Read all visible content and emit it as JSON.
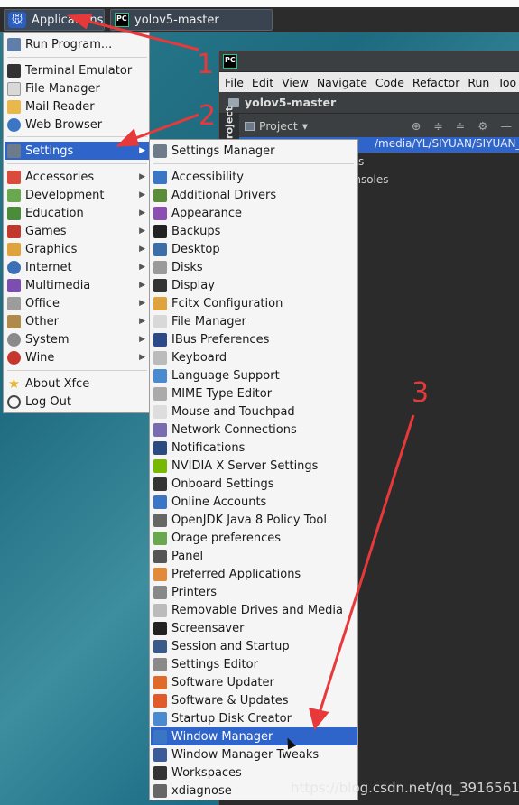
{
  "panel": {
    "apps_label": "Applications",
    "task_label": "yolov5-master"
  },
  "ide": {
    "app_icon": "PC",
    "menus": [
      "File",
      "Edit",
      "View",
      "Navigate",
      "Code",
      "Refactor",
      "Run",
      "Too"
    ],
    "project_path": "yolov5-master",
    "side_tab": "Project",
    "project_dropdown": "Project",
    "selected_row": "/media/YL/SIYUAN/SIYUAN_co",
    "row2": "s",
    "row3": "onsoles"
  },
  "apps_menu": {
    "items": [
      {
        "label": "Run Program...",
        "icon": "run-program-icon",
        "color": "#5f7fa8"
      },
      {
        "label": "Terminal Emulator",
        "icon": "terminal-icon",
        "color": "#333333"
      },
      {
        "label": "File Manager",
        "icon": "file-manager-icon",
        "color": "#d8d8d8"
      },
      {
        "label": "Mail Reader",
        "icon": "mail-icon",
        "color": "#e8b84a"
      },
      {
        "label": "Web Browser",
        "icon": "web-browser-icon",
        "color": "#3a76c4"
      },
      {
        "label": "Settings",
        "icon": "settings-icon",
        "color": "#6d7b8a"
      },
      {
        "label": "Accessories",
        "icon": "accessories-icon",
        "color": "#d94b3a"
      },
      {
        "label": "Development",
        "icon": "development-icon",
        "color": "#6aa84f"
      },
      {
        "label": "Education",
        "icon": "education-icon",
        "color": "#4a8c3a"
      },
      {
        "label": "Games",
        "icon": "games-icon",
        "color": "#c0392b"
      },
      {
        "label": "Graphics",
        "icon": "graphics-icon",
        "color": "#e0a23a"
      },
      {
        "label": "Internet",
        "icon": "internet-icon",
        "color": "#3c6fb3"
      },
      {
        "label": "Multimedia",
        "icon": "multimedia-icon",
        "color": "#7a4fb0"
      },
      {
        "label": "Office",
        "icon": "office-icon",
        "color": "#9c9c9c"
      },
      {
        "label": "Other",
        "icon": "other-icon",
        "color": "#b08a4a"
      },
      {
        "label": "System",
        "icon": "system-icon",
        "color": "#8a8a8a"
      },
      {
        "label": "Wine",
        "icon": "wine-icon",
        "color": "#c8372e"
      },
      {
        "label": "About Xfce",
        "icon": "about-star-icon",
        "color": "#e8b830"
      },
      {
        "label": "Log Out",
        "icon": "log-out-icon",
        "color": "#444444"
      }
    ]
  },
  "settings_menu": {
    "items": [
      {
        "label": "Settings Manager",
        "color": "#6d7b8a"
      },
      {
        "label": "Accessibility",
        "color": "#3a76c4"
      },
      {
        "label": "Additional Drivers",
        "color": "#5a8c3a"
      },
      {
        "label": "Appearance",
        "color": "#8a4fb0"
      },
      {
        "label": "Backups",
        "color": "#222222"
      },
      {
        "label": "Desktop",
        "color": "#3b6ea8"
      },
      {
        "label": "Disks",
        "color": "#9a9a9a"
      },
      {
        "label": "Display",
        "color": "#333333"
      },
      {
        "label": "Fcitx Configuration",
        "color": "#e0a23a"
      },
      {
        "label": "File Manager",
        "color": "#d8d8d8"
      },
      {
        "label": "IBus Preferences",
        "color": "#2c4a8a"
      },
      {
        "label": "Keyboard",
        "color": "#bbbbbb"
      },
      {
        "label": "Language Support",
        "color": "#4a8ad0"
      },
      {
        "label": "MIME Type Editor",
        "color": "#aaaaaa"
      },
      {
        "label": "Mouse and Touchpad",
        "color": "#dddddd"
      },
      {
        "label": "Network Connections",
        "color": "#7a6ab0"
      },
      {
        "label": "Notifications",
        "color": "#2a4a80"
      },
      {
        "label": "NVIDIA X Server Settings",
        "color": "#76b900"
      },
      {
        "label": "Onboard Settings",
        "color": "#333333"
      },
      {
        "label": "Online Accounts",
        "color": "#3a76c4"
      },
      {
        "label": "OpenJDK Java 8 Policy Tool",
        "color": "#666666"
      },
      {
        "label": "Orage preferences",
        "color": "#6aa84f"
      },
      {
        "label": "Panel",
        "color": "#555555"
      },
      {
        "label": "Preferred Applications",
        "color": "#e08a3a"
      },
      {
        "label": "Printers",
        "color": "#888888"
      },
      {
        "label": "Removable Drives and Media",
        "color": "#bbbbbb"
      },
      {
        "label": "Screensaver",
        "color": "#222222"
      },
      {
        "label": "Session and Startup",
        "color": "#3a5a8a"
      },
      {
        "label": "Settings Editor",
        "color": "#8a8a8a"
      },
      {
        "label": "Software Updater",
        "color": "#e06a2a"
      },
      {
        "label": "Software & Updates",
        "color": "#e05a2a"
      },
      {
        "label": "Startup Disk Creator",
        "color": "#4a8ad0"
      },
      {
        "label": "Window Manager",
        "color": "#3a76c4"
      },
      {
        "label": "Window Manager Tweaks",
        "color": "#3a5a9a"
      },
      {
        "label": "Workspaces",
        "color": "#333333"
      },
      {
        "label": "xdiagnose",
        "color": "#666666"
      }
    ]
  },
  "annotations": [
    "1",
    "2",
    "3"
  ],
  "watermark": "https://blog.csdn.net/qq_39165617",
  "colors": {
    "selection": "#2f65ca",
    "arrow": "#e8393a"
  }
}
